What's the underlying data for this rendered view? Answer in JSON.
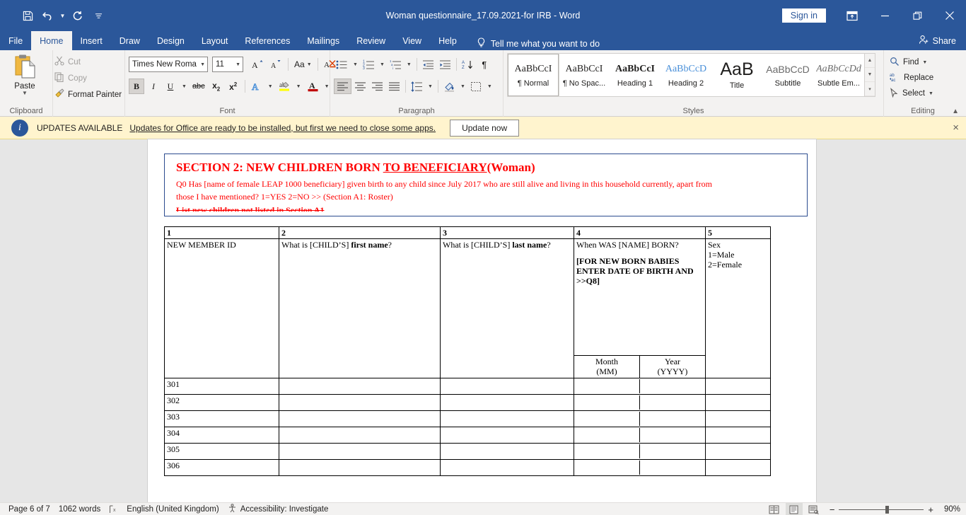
{
  "titlebar": {
    "document_title": "Woman questionnaire_17.09.2021-for IRB  -  Word",
    "quick_access": [
      {
        "name": "save-icon",
        "label": "Save"
      },
      {
        "name": "undo-icon",
        "label": "Undo"
      },
      {
        "name": "redo-icon",
        "label": "Redo"
      },
      {
        "name": "customize-quick-access-toolbar-icon",
        "label": "Customize Quick Access Toolbar"
      }
    ],
    "sign_in": "Sign in",
    "ribbon_display_options": "Ribbon Display Options",
    "minimize": "Minimize",
    "restore": "Restore Down",
    "close": "Close",
    "accent_color": "#2b579a"
  },
  "tabs": [
    {
      "label": "File",
      "active": false
    },
    {
      "label": "Home",
      "active": true
    },
    {
      "label": "Insert",
      "active": false
    },
    {
      "label": "Draw",
      "active": false
    },
    {
      "label": "Design",
      "active": false
    },
    {
      "label": "Layout",
      "active": false
    },
    {
      "label": "References",
      "active": false
    },
    {
      "label": "Mailings",
      "active": false
    },
    {
      "label": "Review",
      "active": false
    },
    {
      "label": "View",
      "active": false
    },
    {
      "label": "Help",
      "active": false
    }
  ],
  "tell_me": "Tell me what you want to do",
  "share": "Share",
  "ribbon": {
    "clipboard": {
      "group_label": "Clipboard",
      "paste": "Paste",
      "cut": "Cut",
      "copy": "Copy",
      "format_painter": "Format Painter"
    },
    "font": {
      "group_label": "Font",
      "font_name": "Times New Roma",
      "font_size": "11",
      "grow_font": "A",
      "shrink_font": "A",
      "change_case": "Aa",
      "clear_formatting": "Clear All Formatting",
      "bold": "B",
      "italic": "I",
      "underline": "U",
      "strikethrough": "abc",
      "subscript": "x",
      "superscript": "x",
      "text_effects": "A",
      "text_highlight": "ab",
      "font_color": "A"
    },
    "paragraph": {
      "group_label": "Paragraph",
      "bullets": "Bullets",
      "numbering": "Numbering",
      "multilevel_list": "Multilevel List",
      "decrease_indent": "Decrease Indent",
      "increase_indent": "Increase Indent",
      "sort": "Sort",
      "show_marks": "¶",
      "align_left": "Align Left",
      "center": "Center",
      "align_right": "Align Right",
      "justify": "Justify",
      "line_spacing": "Line and Paragraph Spacing",
      "shading": "Shading",
      "borders": "Borders"
    },
    "styles": {
      "group_label": "Styles",
      "items": [
        {
          "preview": "AaBbCcI",
          "name": "¶ Normal",
          "selected": true
        },
        {
          "preview": "AaBbCcI",
          "name": "¶ No Spac...",
          "selected": false
        },
        {
          "preview": "AaBbCcI",
          "name": "Heading 1",
          "selected": false
        },
        {
          "preview": "AaBbCcD",
          "name": "Heading 2",
          "selected": false
        },
        {
          "preview": "AaB",
          "name": "Title",
          "selected": false
        },
        {
          "preview": "AaBbCcD",
          "name": "Subtitle",
          "selected": false
        },
        {
          "preview": "AaBbCcDd",
          "name": "Subtle Em...",
          "selected": false
        }
      ]
    },
    "editing": {
      "group_label": "Editing",
      "find": "Find",
      "replace": "Replace",
      "select": "Select"
    }
  },
  "update_bar": {
    "title": "UPDATES AVAILABLE",
    "message": "Updates for Office are ready to be installed, but first we need to close some apps.",
    "button": "Update now",
    "close": "×",
    "background": "#fff4ce"
  },
  "document": {
    "section_title_part1": "SECTION 2: NEW CHILDREN BORN ",
    "section_title_underlined": "TO  BENEFICIARY",
    "section_title_part2": "(Woman)",
    "q0_line1": "Q0 Has [name of female LEAP 1000 beneficiary] given birth to any child since July 2017 who are still alive and living in this household currently, apart from",
    "q0_line2": "those I have mentioned?  1=YES   2=NO >> (Section A1: Roster)",
    "list_new": "List new children not listed in Section A1",
    "text_color": "#ff0000",
    "border_color": "#2b4b8f",
    "table": {
      "column_numbers": [
        "1",
        "2",
        "3",
        "4",
        "5"
      ],
      "headers": [
        {
          "text": "NEW MEMBER ID"
        },
        {
          "prefix": "What is [CHILD’S] ",
          "bold": "first name",
          "suffix": "?"
        },
        {
          "prefix": "What is [CHILD’S] ",
          "bold": "last name",
          "suffix": "?"
        },
        {
          "line1": "When WAS [NAME] BORN?",
          "bold_line1": "[FOR NEW BORN BABIES",
          "bold_line2": "ENTER DATE OF BIRTH AND",
          "bold_line3": ">>Q8]",
          "sub_month_l1": "Month",
          "sub_month_l2": "(MM)",
          "sub_year_l1": "Year",
          "sub_year_l2": "(YYYY)"
        },
        {
          "line1": "Sex",
          "line2": "1=Male",
          "line3": "2=Female"
        }
      ],
      "rows": [
        {
          "id": "301"
        },
        {
          "id": "302"
        },
        {
          "id": "303"
        },
        {
          "id": "304"
        },
        {
          "id": "305"
        },
        {
          "id": "306"
        }
      ]
    }
  },
  "statusbar": {
    "page": "Page 6 of 7",
    "words": "1062 words",
    "proofing_icon": "proofing-errors-icon",
    "language": "English (United Kingdom)",
    "accessibility": "Accessibility: Investigate",
    "view_read_mode": "Read Mode",
    "view_print_layout": "Print Layout",
    "view_web_layout": "Web Layout",
    "zoom_out": "−",
    "zoom_in": "+",
    "zoom_level": "90%"
  }
}
